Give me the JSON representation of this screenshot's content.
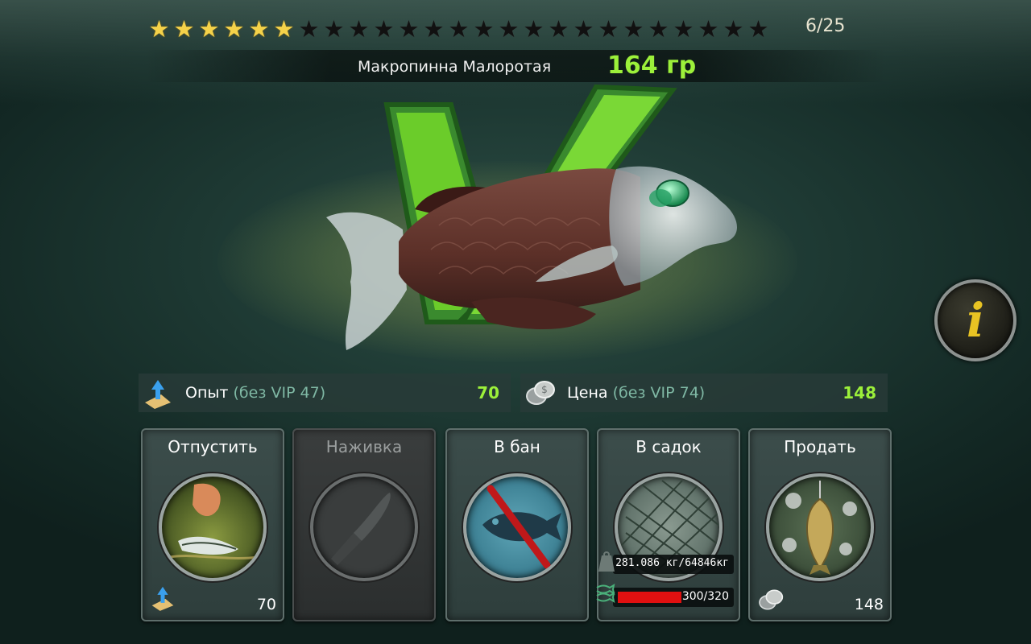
{
  "stars": {
    "filled": 6,
    "total": 25,
    "label": "6/25"
  },
  "fish": {
    "name": "Макропинна Малоротая",
    "weight": "164 гр"
  },
  "info_button": {
    "glyph": "i"
  },
  "stats": {
    "xp": {
      "label": "Опыт",
      "sub": "(без VIP 47)",
      "value": "70"
    },
    "price": {
      "label": "Цена",
      "sub": "(без VIP 74)",
      "value": "148"
    }
  },
  "actions": [
    {
      "id": "release",
      "title": "Отпустить",
      "count": "70",
      "enabled": true
    },
    {
      "id": "bait",
      "title": "Наживка",
      "enabled": false
    },
    {
      "id": "ban",
      "title": "В бан",
      "enabled": true
    },
    {
      "id": "keepnet",
      "title": "В садок",
      "weight": "281.086 кг/64846кг",
      "capacity": "300/320",
      "capacity_fraction": 0.9375,
      "enabled": true
    },
    {
      "id": "sell",
      "title": "Продать",
      "count": "148",
      "enabled": true
    }
  ],
  "colors": {
    "accent_green": "#9cf03a",
    "star": "#f5d24a",
    "info": "#e8c323"
  }
}
